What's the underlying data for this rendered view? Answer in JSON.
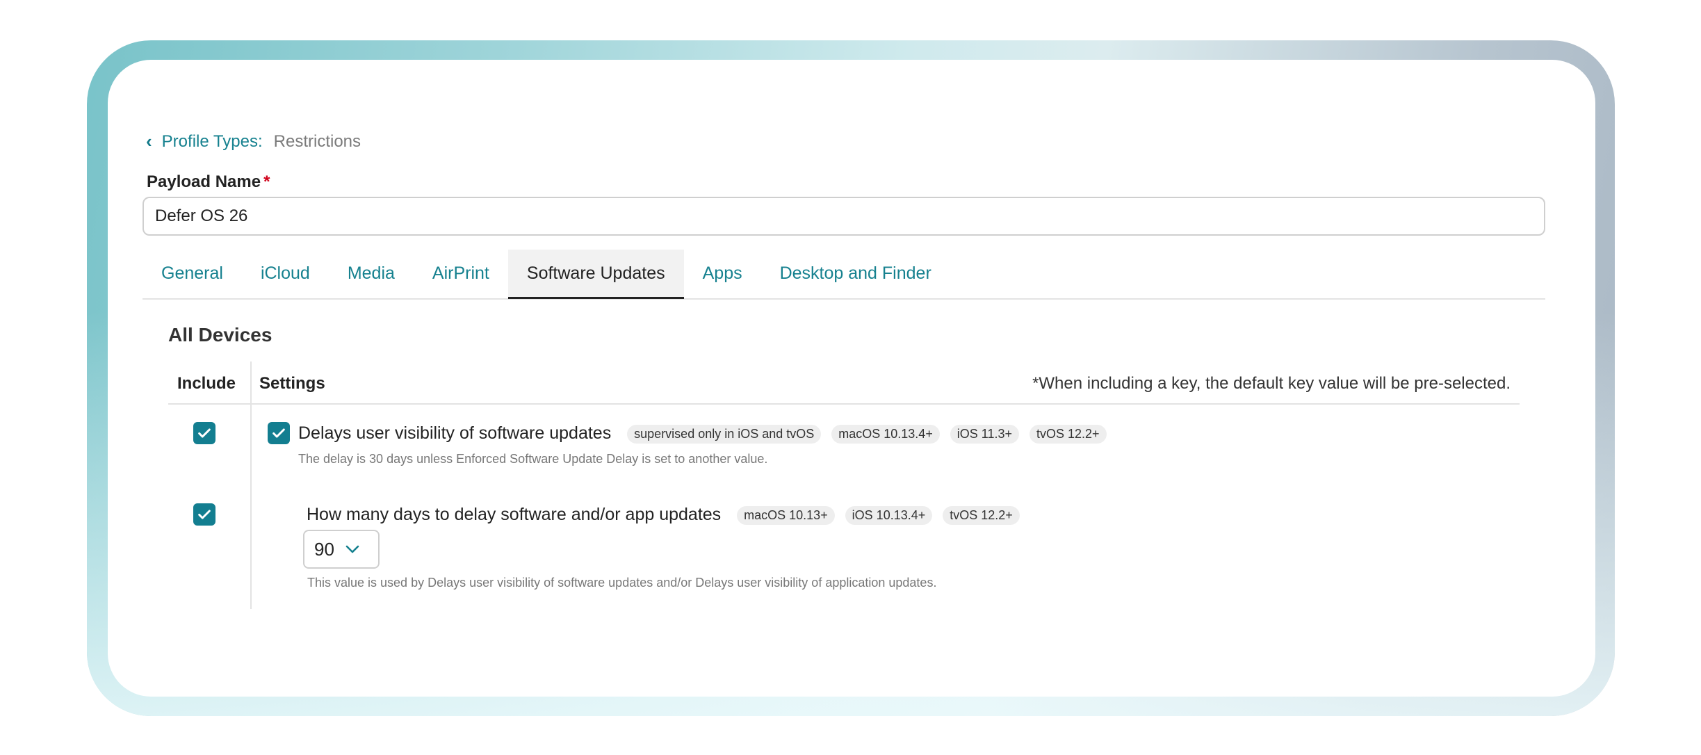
{
  "breadcrumb": {
    "parent": "Profile Types:",
    "current": "Restrictions"
  },
  "payload_name": {
    "label": "Payload Name",
    "required_mark": "*",
    "value": "Defer OS 26"
  },
  "tabs": [
    {
      "label": "General",
      "active": false
    },
    {
      "label": "iCloud",
      "active": false
    },
    {
      "label": "Media",
      "active": false
    },
    {
      "label": "AirPrint",
      "active": false
    },
    {
      "label": "Software Updates",
      "active": true
    },
    {
      "label": "Apps",
      "active": false
    },
    {
      "label": "Desktop and Finder",
      "active": false
    }
  ],
  "section": {
    "title": "All Devices",
    "headers": {
      "include": "Include",
      "settings": "Settings"
    },
    "note": "*When including a key, the default key value will be pre-selected."
  },
  "rows": [
    {
      "title": "Delays user visibility of software updates",
      "badges": [
        "supervised only in iOS and tvOS",
        "macOS 10.13.4+",
        "iOS 11.3+",
        "tvOS 12.2+"
      ],
      "hint": "The delay is 30 days unless Enforced Software Update Delay is set to another value.",
      "include_checked": true,
      "setting_checked": true
    },
    {
      "title": "How many days to delay software and/or app updates",
      "badges": [
        "macOS 10.13+",
        "iOS 10.13.4+",
        "tvOS 12.2+"
      ],
      "select_value": "90",
      "hint": "This value is used by Delays user visibility of software updates and/or Delays user visibility of application updates.",
      "include_checked": true
    }
  ],
  "colors": {
    "accent": "#137e90",
    "link": "#16818f",
    "required": "#d0021b"
  },
  "icons": {
    "back": "chevron-left-icon",
    "check": "checkmark-icon",
    "dropdown": "chevron-down-icon"
  }
}
